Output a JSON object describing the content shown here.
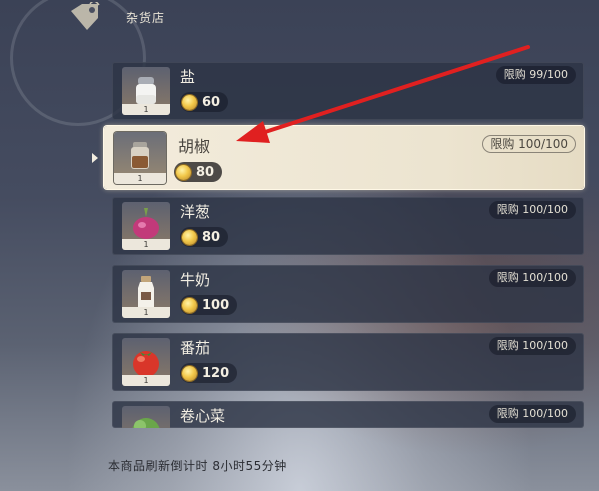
{
  "shop": {
    "title": "杂货店",
    "icon": "price-tag-icon"
  },
  "items": [
    {
      "name": "盐",
      "price": "60",
      "limit": "限购 99/100",
      "count": "1",
      "icon": "salt-shaker-icon"
    },
    {
      "name": "胡椒",
      "price": "80",
      "limit": "限购 100/100",
      "count": "1",
      "icon": "pepper-jar-icon",
      "selected": true
    },
    {
      "name": "洋葱",
      "price": "80",
      "limit": "限购 100/100",
      "count": "1",
      "icon": "onion-icon"
    },
    {
      "name": "牛奶",
      "price": "100",
      "limit": "限购 100/100",
      "count": "1",
      "icon": "milk-bottle-icon"
    },
    {
      "name": "番茄",
      "price": "120",
      "limit": "限购 100/100",
      "count": "1",
      "icon": "tomato-icon"
    },
    {
      "name": "卷心菜",
      "price": "",
      "limit": "限购 100/100",
      "count": "",
      "icon": "cabbage-icon"
    }
  ],
  "footer": {
    "refresh_text": "本商品刷新倒计时 8小时55分钟"
  },
  "colors": {
    "selected_bg": "#f3ecdc",
    "row_bg": "#2d3446",
    "annotation_arrow": "#e02020",
    "coin": "#f2c84a"
  }
}
